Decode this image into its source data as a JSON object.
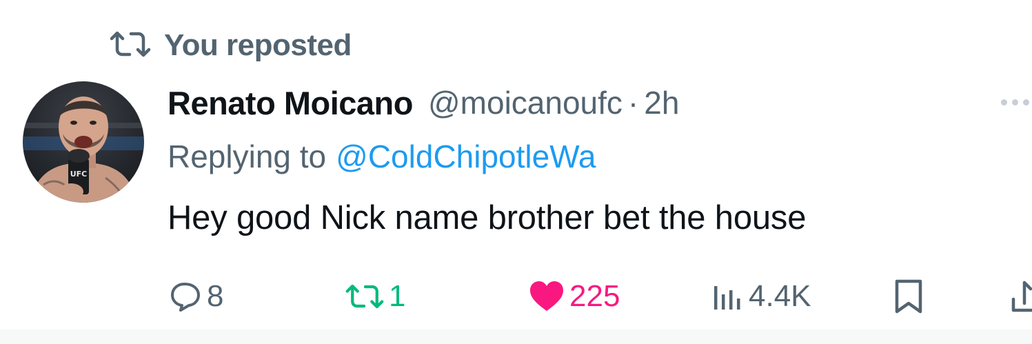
{
  "repost_banner": {
    "text": "You reposted",
    "icon": "repost-icon"
  },
  "tweet": {
    "author_name": "Renato Moicano",
    "author_handle": "@moicanoufc",
    "separator": "·",
    "timestamp": "2h",
    "reply_prefix": "Replying to",
    "reply_to": "@ColdChipotleWa",
    "text": "Hey good Nick name brother bet the house",
    "avatar_badge": "UFC"
  },
  "actions": {
    "replies": "8",
    "reposts": "1",
    "likes": "225",
    "views": "4.4K"
  },
  "colors": {
    "link": "#1d9bf0",
    "muted": "#536471",
    "repost_active": "#00ba7c",
    "like_active": "#f91880"
  }
}
